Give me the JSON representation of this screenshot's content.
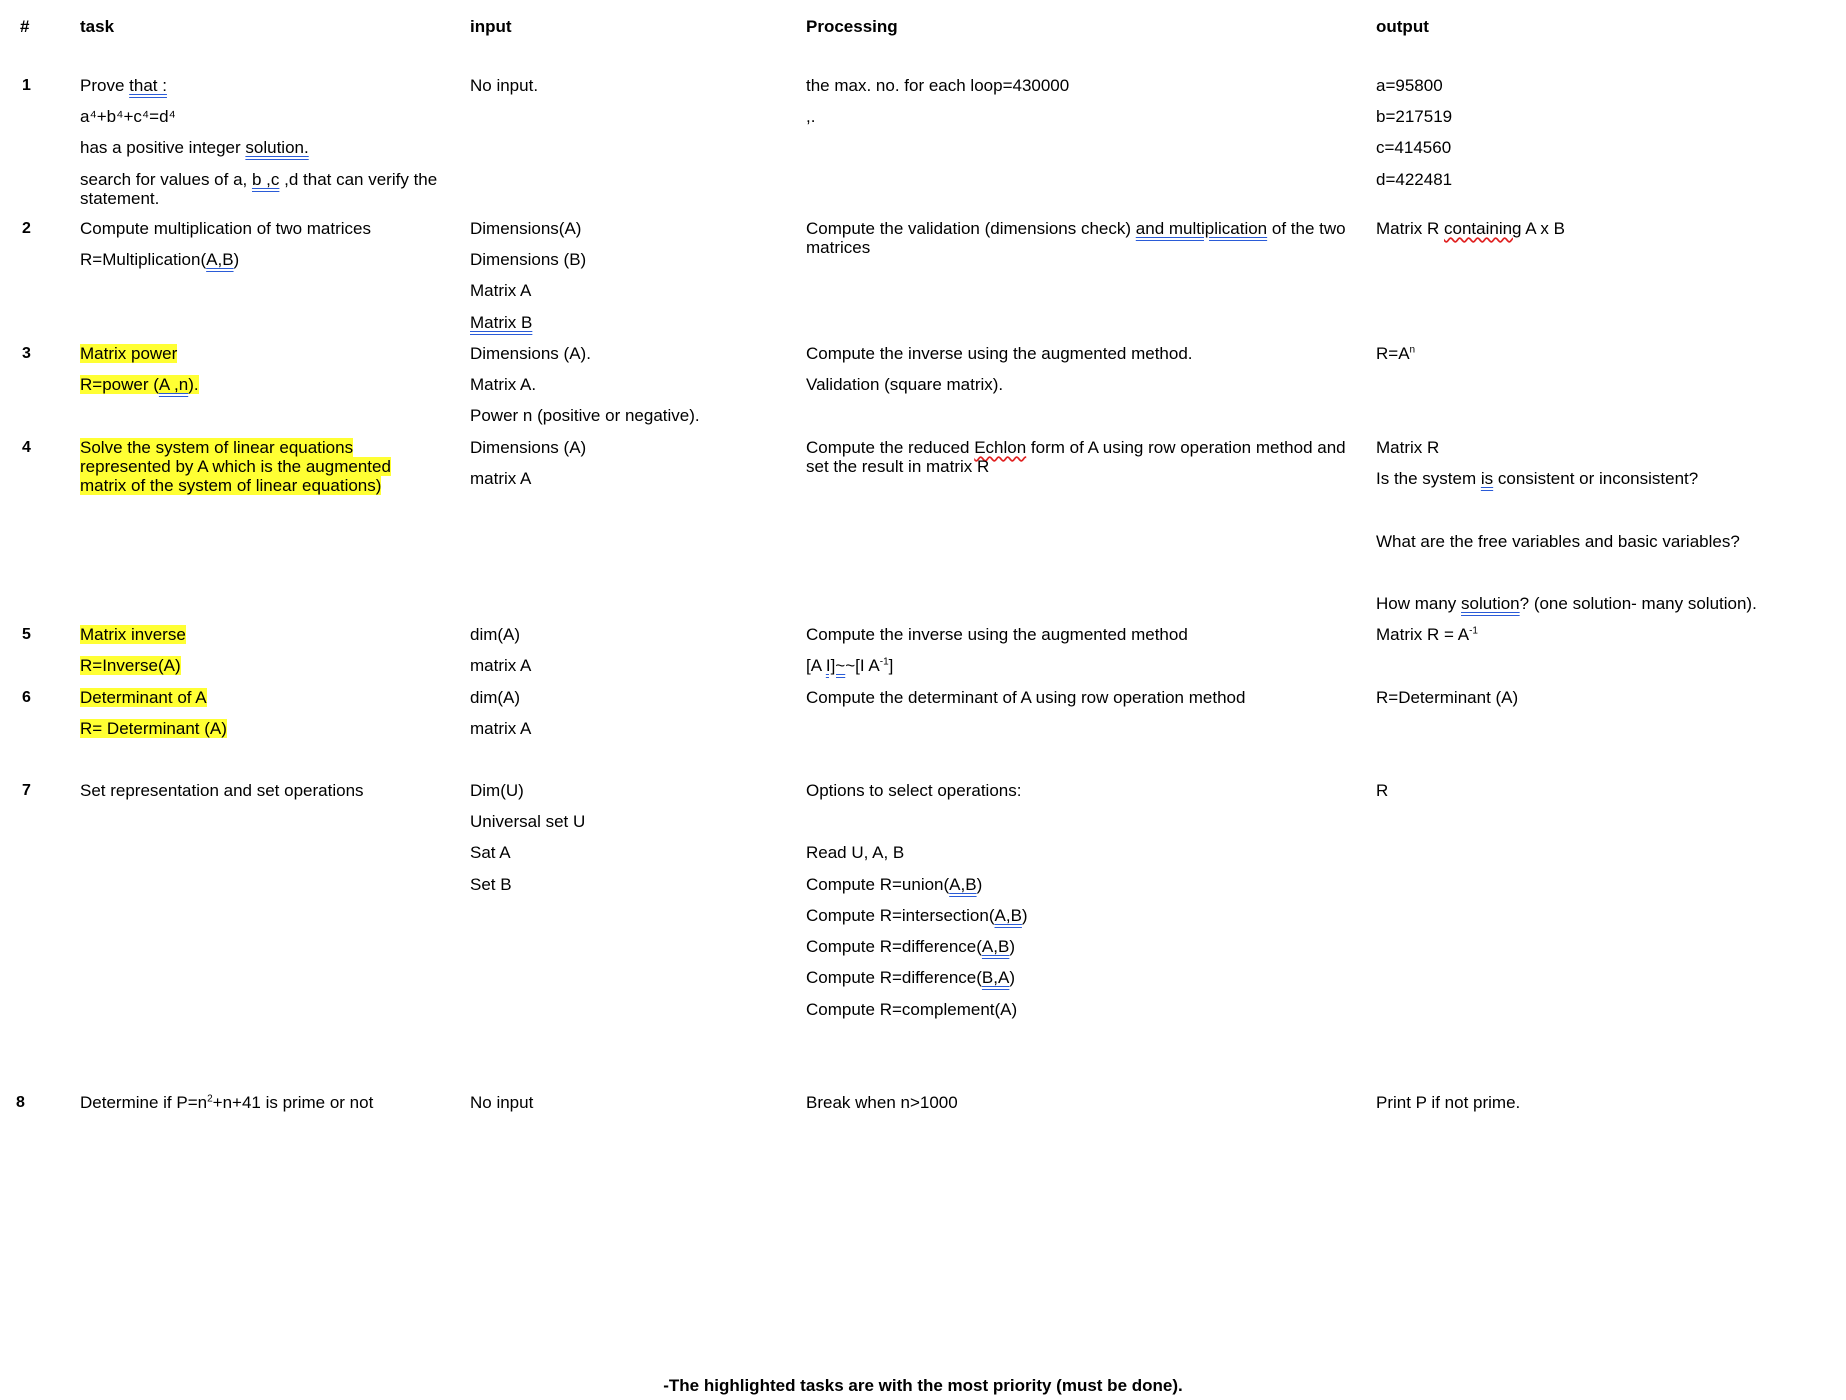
{
  "headers": {
    "num": "#",
    "task": "task",
    "input": "input",
    "processing": "Processing",
    "output": "output"
  },
  "rows": [
    {
      "num": "1"
    },
    {
      "num": "2"
    },
    {
      "num": "3"
    },
    {
      "num": "4"
    },
    {
      "num": "5"
    },
    {
      "num": "6"
    },
    {
      "num": "7"
    },
    {
      "num": "8"
    }
  ],
  "r1": {
    "task_prove": "Prove ",
    "task_that": "that :",
    "task_eq": "a⁴+b⁴+c⁴=d⁴",
    "task_has": "has a positive integer ",
    "task_solution": "solution.",
    "task_search_a": "search for values of    a, ",
    "task_bc": "b ,c",
    "task_search_b": " ,d that can verify the statement.",
    "input": "No input.",
    "proc1": "the max. no. for each loop=430000",
    "proc2": ",.",
    "out_a": "a=95800",
    "out_b": "b=217519",
    "out_c": "c=414560",
    "out_d": "d=422481"
  },
  "r2": {
    "task1": "Compute multiplication of two matrices",
    "task2_a": "R=Multiplication(",
    "task2_ab": "A,B",
    "task2_b": ")",
    "in1": "Dimensions(A)",
    "in2": "Dimensions (B)",
    "in3": "Matrix A",
    "in4": "Matrix  B",
    "proc_a": "Compute the validation (dimensions check) ",
    "proc_u": "and  multiplication",
    "proc_b": " of the two matrices",
    "out_a": "Matrix R ",
    "out_u": "containing",
    "out_b": " A x B"
  },
  "r3": {
    "task1": "Matrix power",
    "task2_a": "R=power (",
    "task2_u": "A ,n",
    "task2_b": ").",
    "in1": "Dimensions (A).",
    "in2": "Matrix A.",
    "in3": "Power n (positive or negative).",
    "proc1": "Compute the inverse using the augmented method.",
    "proc2": "Validation (square matrix).",
    "out_a": "R=A",
    "out_sup": "n"
  },
  "r4": {
    "task": "Solve the system of linear equations represented by A which is the augmented matrix of the system of linear equations)",
    "in1": "Dimensions (A)",
    "in2": "matrix A",
    "proc_a": "Compute the reduced ",
    "proc_u": "Echlon",
    "proc_b": " form of A using row operation method and set the result in matrix R",
    "out1": "Matrix R",
    "out2_a": "Is the system ",
    "out2_u": "is",
    "out2_b": " consistent or inconsistent?",
    "out3": "What are the free variables and basic variables?",
    "out4_a": "How many ",
    "out4_u": "solution",
    "out4_b": "? (one solution- many solution)."
  },
  "r5": {
    "task1": "Matrix inverse",
    "task2": "R=Inverse(A)",
    "in1": "dim(A)",
    "in2": "matrix A",
    "proc1": "Compute the inverse using the augmented method",
    "proc2_a": "[A ",
    "proc2_u": "I]~",
    "proc2_b": "~[I A",
    "proc2_sup": "-1",
    "proc2_c": "]",
    "out_a": "Matrix R = A",
    "out_sup": "-1"
  },
  "r6": {
    "task1": "Determinant of A",
    "task2": "R= Determinant (A)",
    "in1": "dim(A)",
    "in2": "matrix A",
    "proc": "Compute the determinant of A using row operation method",
    "out": "R=Determinant (A)"
  },
  "r7": {
    "task": "Set representation and set operations",
    "in1": "Dim(U)",
    "in2": "Universal set U",
    "in3": "Sat A",
    "in4": "Set B",
    "proc1": "Options to select operations:",
    "proc2": "Read U, A, B",
    "proc3_a": "Compute R=union(",
    "proc3_u": "A,B",
    "proc4_a": "Compute R=intersection(",
    "proc4_u": "A,B",
    "proc5_a": "Compute R=difference(",
    "proc5_u": "A,B",
    "proc6_a": "Compute R=difference(",
    "proc6_u": "B,A",
    "proc_close": ")",
    "proc7": "Compute R=complement(A)",
    "out": "R"
  },
  "r8": {
    "task_a": "Determine if P=n",
    "task_sup": "2",
    "task_b": "+n+41 is prime or not",
    "input": "No input",
    "proc": "Break when n>1000",
    "out": "Print P if not prime."
  },
  "footer": "-The highlighted tasks are with the most priority (must be done).",
  "colors": {
    "highlight": "#ffff33",
    "underline_blue": "#2a5bd7",
    "underline_red": "#e02020"
  }
}
